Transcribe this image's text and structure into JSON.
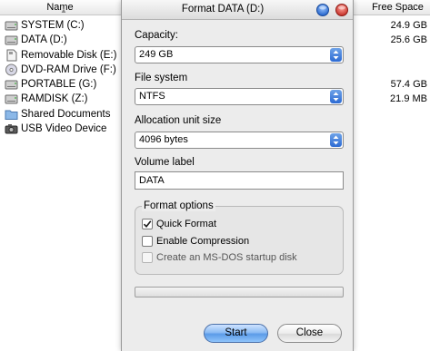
{
  "explorer": {
    "columns": {
      "name": "Name",
      "free_space": "Free Space"
    },
    "drives": [
      {
        "label": "SYSTEM (C:)",
        "icon": "hard-drive-icon"
      },
      {
        "label": "DATA (D:)",
        "icon": "hard-drive-icon"
      },
      {
        "label": "Removable Disk (E:)",
        "icon": "removable-disk-icon"
      },
      {
        "label": "DVD-RAM Drive (F:)",
        "icon": "dvd-drive-icon"
      },
      {
        "label": "PORTABLE (G:)",
        "icon": "hard-drive-icon"
      },
      {
        "label": "RAMDISK (Z:)",
        "icon": "hard-drive-icon"
      },
      {
        "label": "Shared Documents",
        "icon": "folder-icon"
      },
      {
        "label": "USB Video Device",
        "icon": "camera-icon"
      }
    ],
    "free_space": [
      "24.9 GB",
      "25.6 GB",
      "",
      "",
      "57.4 GB",
      "21.9 MB",
      "",
      ""
    ]
  },
  "dialog": {
    "title": "Format DATA (D:)",
    "capacity": {
      "label": "Capacity:",
      "value": "249 GB"
    },
    "file_system": {
      "label": "File system",
      "value": "NTFS"
    },
    "allocation": {
      "label": "Allocation unit size",
      "value": "4096 bytes"
    },
    "volume": {
      "label": "Volume label",
      "value": "DATA"
    },
    "format_options": {
      "title": "Format options",
      "quick_format": {
        "label": "Quick Format",
        "checked": true
      },
      "enable_compression": {
        "label": "Enable Compression",
        "checked": false
      },
      "msdos_startup": {
        "label": "Create an MS-DOS startup disk",
        "checked": false,
        "disabled": true
      }
    },
    "progress": 0,
    "buttons": {
      "start": "Start",
      "close": "Close"
    }
  },
  "colors": {
    "accent": "#3b7be3",
    "close_button": "#d6463e",
    "help_button": "#2f6fd6"
  }
}
